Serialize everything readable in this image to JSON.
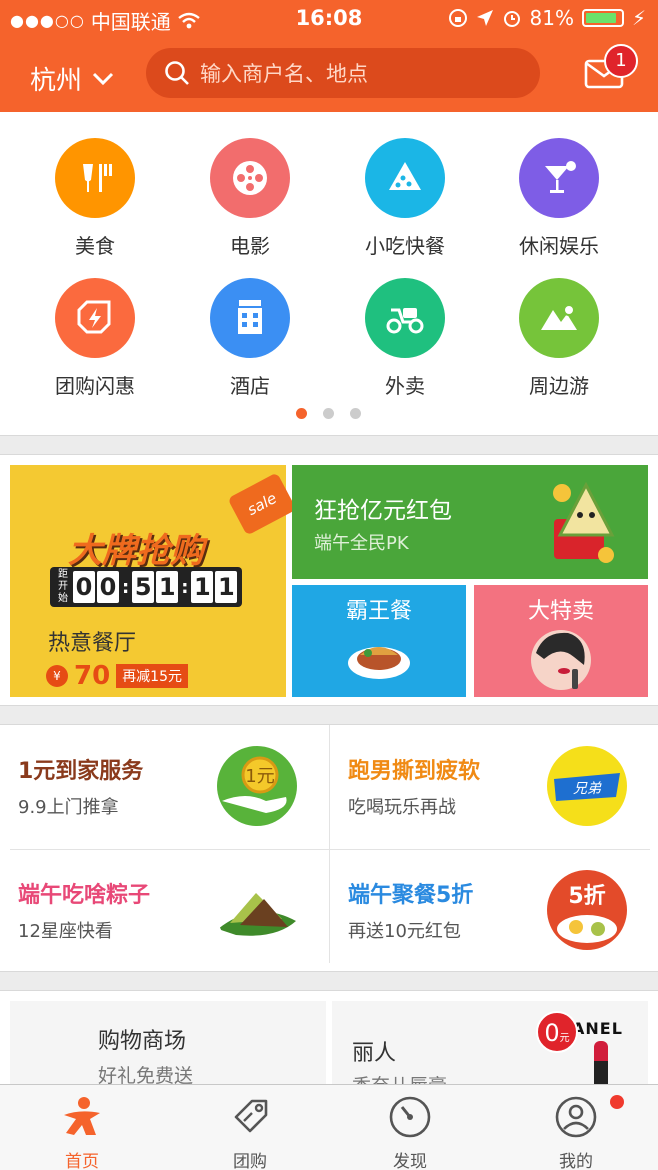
{
  "status_bar": {
    "carrier": "中国联通",
    "time": "16:08",
    "battery": "81%"
  },
  "header": {
    "city": "杭州",
    "search_placeholder": "输入商户名、地点",
    "mail_badge": "1"
  },
  "categories": [
    {
      "label": "美食",
      "icon": "food-icon",
      "color": "#ff9500"
    },
    {
      "label": "电影",
      "icon": "film-reel-icon",
      "color": "#f26d6d"
    },
    {
      "label": "小吃快餐",
      "icon": "pizza-icon",
      "color": "#1bb6e6"
    },
    {
      "label": "休闲娱乐",
      "icon": "cocktail-icon",
      "color": "#7e5de6"
    },
    {
      "label": "团购闪惠",
      "icon": "flash-tag-icon",
      "color": "#fb6a3e"
    },
    {
      "label": "酒店",
      "icon": "hotel-icon",
      "color": "#3b8ff3"
    },
    {
      "label": "外卖",
      "icon": "scooter-icon",
      "color": "#1fc07f"
    },
    {
      "label": "周边游",
      "icon": "mountain-icon",
      "color": "#76c43a"
    }
  ],
  "pager": {
    "pages": 3,
    "active": 0
  },
  "promo": {
    "brand_title": "大牌抢购",
    "sale_tag": "sale",
    "countdown_label": "距开始",
    "countdown": [
      "0",
      "0",
      "5",
      "1",
      "1",
      "1"
    ],
    "restaurant": "热意餐厅",
    "currency": "¥",
    "price": "70",
    "discount": "再减15元",
    "red_title": "狂抢亿元红包",
    "red_sub": "端午全民PK",
    "blue_title": "霸王餐",
    "pink_title": "大特卖"
  },
  "features": [
    {
      "title": "1元到家服务",
      "sub": "9.9上门推拿",
      "color": "#8a3a1c",
      "img_color": "#58b33a",
      "img_text": "1元"
    },
    {
      "title": "跑男撕到疲软",
      "sub": "吃喝玩乐再战",
      "color": "#f08a14",
      "img_color": "#f5df1a",
      "img_text": "兄弟"
    },
    {
      "title": "端午吃啥粽子",
      "sub": "12星座快看",
      "color": "#e84877",
      "img_color": "#ffffff",
      "img_text": ""
    },
    {
      "title": "端午聚餐5折",
      "sub": "再送10元红包",
      "color": "#2a8ae0",
      "img_color": "#e34b2a",
      "img_text": "5折"
    }
  ],
  "mall": {
    "left_title": "购物商场",
    "left_sub": "好礼免费送",
    "right_title": "丽人",
    "right_sub": "香奈儿唇膏",
    "zero": "0",
    "zero_unit": "元",
    "brand": "ANEL"
  },
  "tabs": [
    {
      "label": "首页",
      "icon": "home-icon",
      "active": true
    },
    {
      "label": "团购",
      "icon": "tag-icon",
      "active": false
    },
    {
      "label": "发现",
      "icon": "compass-icon",
      "active": false
    },
    {
      "label": "我的",
      "icon": "user-icon",
      "active": false
    }
  ],
  "colors": {
    "brand": "#f5632c",
    "badge": "#e0242b"
  }
}
